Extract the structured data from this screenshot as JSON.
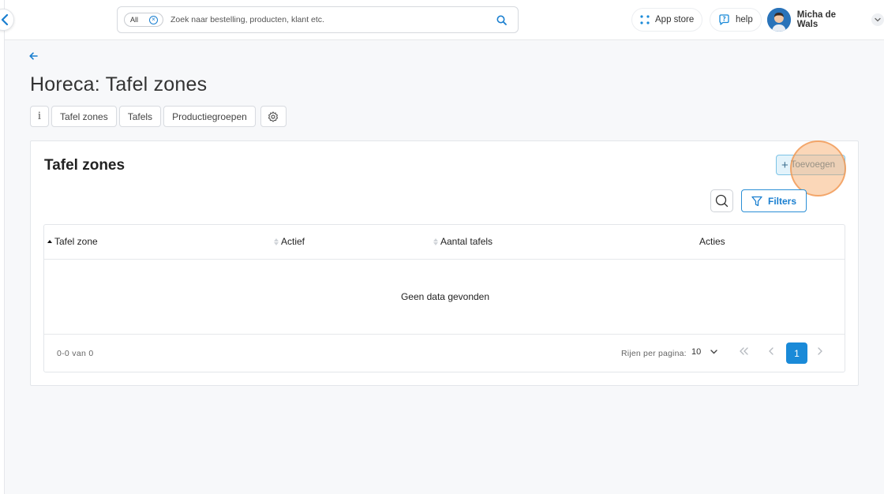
{
  "search": {
    "scope_label": "All",
    "placeholder": "Zoek naar bestelling, producten, klant etc."
  },
  "header": {
    "app_store_label": "App store",
    "help_label": "help",
    "user_name": "Micha de Wals"
  },
  "page": {
    "title": "Horeca: Tafel zones"
  },
  "tabs": [
    {
      "label": "Tafel zones"
    },
    {
      "label": "Tafels"
    },
    {
      "label": "Productiegroepen"
    }
  ],
  "card": {
    "title": "Tafel zones",
    "add_label": "Toevoegen",
    "filters_label": "Filters"
  },
  "table": {
    "columns": [
      {
        "label": "Tafel zone",
        "sort": "asc"
      },
      {
        "label": "Actief",
        "sort": "none"
      },
      {
        "label": "Aantal tafels",
        "sort": "none"
      },
      {
        "label": "Acties",
        "sort": null
      }
    ],
    "empty_message": "Geen data gevonden"
  },
  "pagination": {
    "range_text": "0-0 van 0",
    "rows_label": "Rijen per pagina:",
    "rows_value": "10",
    "current_page": "1"
  },
  "colors": {
    "accent": "#1a8ad8",
    "add_button_bg": "#e3f3fb",
    "click_highlight": "#f6a762"
  }
}
